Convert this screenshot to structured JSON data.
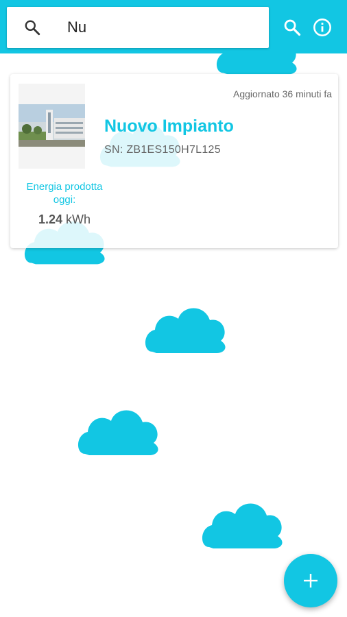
{
  "search": {
    "query": "Nu",
    "icon": "search-icon"
  },
  "toolbar": {
    "search_icon": "search-icon",
    "info_icon": "info-icon"
  },
  "plant_card": {
    "updated": "Aggiornato 36 minuti fa",
    "name": "Nuovo Impianto",
    "serial": "SN: ZB1ES150H7L125",
    "energy_label": "Energia prodotta oggi:",
    "energy_value": "1.24",
    "energy_unit": "kWh"
  },
  "fab": {
    "icon": "plus-icon"
  },
  "colors": {
    "accent": "#12c6e3",
    "background": "#ffffff"
  }
}
